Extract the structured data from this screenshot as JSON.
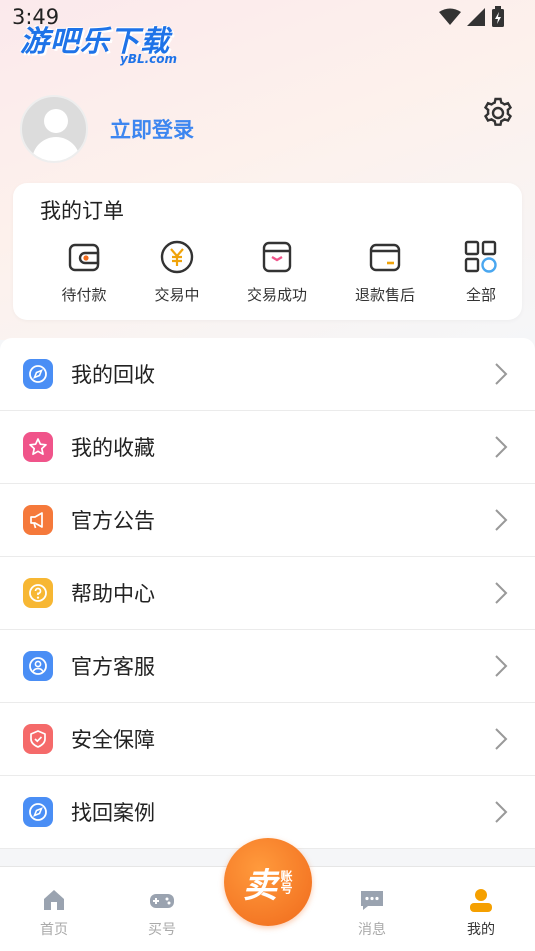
{
  "status_bar": {
    "time": "3:49"
  },
  "watermark": {
    "title": "游吧乐下载",
    "sub": "yBL.com"
  },
  "profile": {
    "login_label": "立即登录"
  },
  "orders": {
    "title": "我的订单",
    "items": [
      {
        "label": "待付款",
        "icon": "wallet-icon"
      },
      {
        "label": "交易中",
        "icon": "yuan-coin-icon"
      },
      {
        "label": "交易成功",
        "icon": "success-bag-icon"
      },
      {
        "label": "退款售后",
        "icon": "refund-card-icon"
      },
      {
        "label": "全部",
        "icon": "grid-icon"
      }
    ]
  },
  "menu": [
    {
      "label": "我的回收",
      "icon": "compass-icon",
      "color": "#4a8ef5"
    },
    {
      "label": "我的收藏",
      "icon": "star-icon",
      "color": "#f0548a"
    },
    {
      "label": "官方公告",
      "icon": "megaphone-icon",
      "color": "#f5793b"
    },
    {
      "label": "帮助中心",
      "icon": "help-icon",
      "color": "#f7b733"
    },
    {
      "label": "官方客服",
      "icon": "service-icon",
      "color": "#4a8ef5"
    },
    {
      "label": "安全保障",
      "icon": "shield-icon",
      "color": "#f56a6a"
    },
    {
      "label": "找回案例",
      "icon": "compass-icon",
      "color": "#4a8ef5"
    }
  ],
  "tabbar": {
    "items": [
      {
        "label": "首页",
        "icon": "home-icon",
        "active": false
      },
      {
        "label": "买号",
        "icon": "gamepad-icon",
        "active": false
      },
      {
        "label": "消息",
        "icon": "message-icon",
        "active": false
      },
      {
        "label": "我的",
        "icon": "user-icon",
        "active": true
      }
    ],
    "sell": {
      "main": "卖",
      "sub": "账号"
    }
  }
}
